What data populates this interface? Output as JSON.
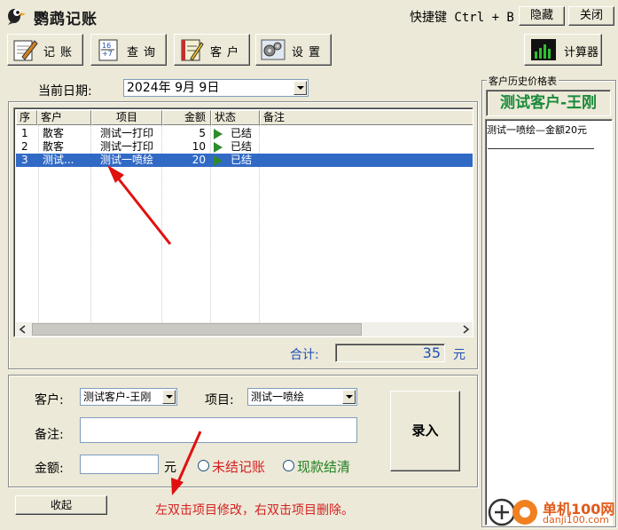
{
  "window": {
    "title": "鹦鹉记账",
    "shortcut": "快捷键 Ctrl + B",
    "hide_label": "隐藏",
    "close_label": "关闭"
  },
  "toolbar": {
    "record": "记账",
    "query": "查询",
    "customer": "客户",
    "settings": "设置",
    "calculator": "计算器"
  },
  "date": {
    "label": "当前日期:",
    "value": "2024年  9月  9日"
  },
  "table": {
    "columns": [
      "序",
      "客户",
      "项目",
      "金额",
      "状态",
      "备注"
    ],
    "rows": [
      {
        "no": "1",
        "customer": "散客",
        "item": "测试一打印",
        "amount": "5",
        "status": "已结",
        "note": "",
        "selected": false
      },
      {
        "no": "2",
        "customer": "散客",
        "item": "测试一打印",
        "amount": "10",
        "status": "已结",
        "note": "",
        "selected": false
      },
      {
        "no": "3",
        "customer": "测试...",
        "item": "测试一喷绘",
        "amount": "20",
        "status": "已结",
        "note": "",
        "selected": true
      }
    ],
    "status_color": "#2e8b2e"
  },
  "total": {
    "label": "合计:",
    "value": "35",
    "unit": "元"
  },
  "entry": {
    "customer_label": "客户:",
    "customer_value": "测试客户-王刚",
    "item_label": "项目:",
    "item_value": "测试一喷绘",
    "note_label": "备注:",
    "note_value": "",
    "amount_label": "金额:",
    "amount_value": "",
    "amount_unit": "元",
    "unsettled_label": "未结记账",
    "settled_label": "现款结清",
    "submit_label": "录入"
  },
  "collapse_label": "收起",
  "hint": "左双击项目修改，右双击项目删除。",
  "history": {
    "title": "客户历史价格表",
    "customer": "测试客户-王刚",
    "items": [
      "测试一喷绘—金额20元"
    ]
  },
  "watermark": {
    "text": "单机100网",
    "url": "danji100.com"
  },
  "colors": {
    "accent": "#316ac5",
    "warning": "#d42020",
    "success": "#208020",
    "arrow": "#e01010"
  }
}
